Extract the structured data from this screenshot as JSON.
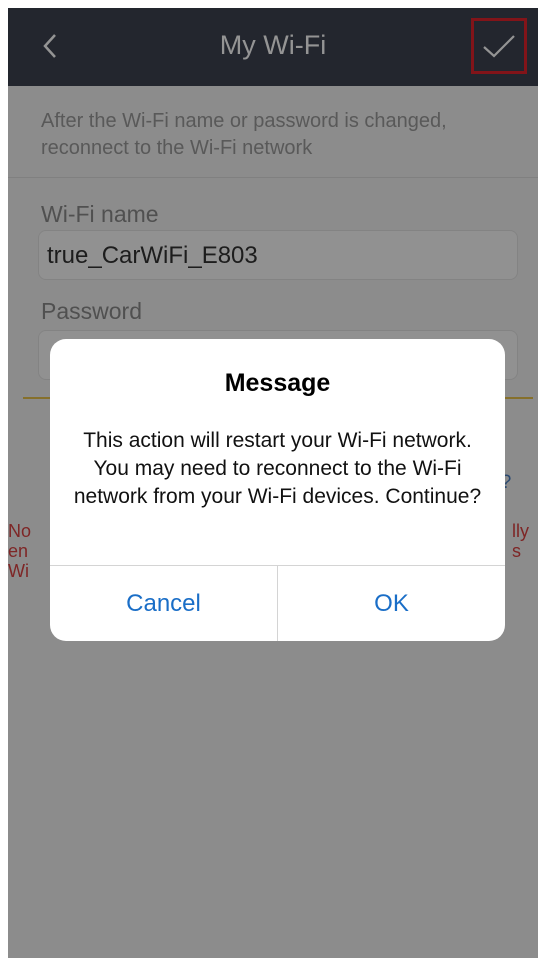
{
  "navbar": {
    "title": "My Wi-Fi",
    "back_icon": "chevron-left-icon",
    "confirm_icon": "checkmark-icon"
  },
  "hint": "After the Wi-Fi name or password is changed, reconnect to the Wi-Fi network",
  "form": {
    "wifi_name_label": "Wi-Fi name",
    "wifi_name_value": "true_CarWiFi_E803",
    "password_label": "Password",
    "password_value": ""
  },
  "background_fragments": {
    "link_partial": "ct?",
    "note_left": "No\nen\nWi",
    "note_right": "lly\ns"
  },
  "dialog": {
    "title": "Message",
    "body": "This action will restart your Wi-Fi network. You may need to reconnect to the Wi-Fi network from your Wi-Fi devices. Continue?",
    "cancel_label": "Cancel",
    "ok_label": "OK"
  },
  "colors": {
    "navbar_bg": "#3d4250",
    "confirm_highlight": "#e0242b",
    "dialog_button": "#1a6ec7",
    "note_red": "#d94242",
    "accent_yellow": "#e7c24a"
  }
}
